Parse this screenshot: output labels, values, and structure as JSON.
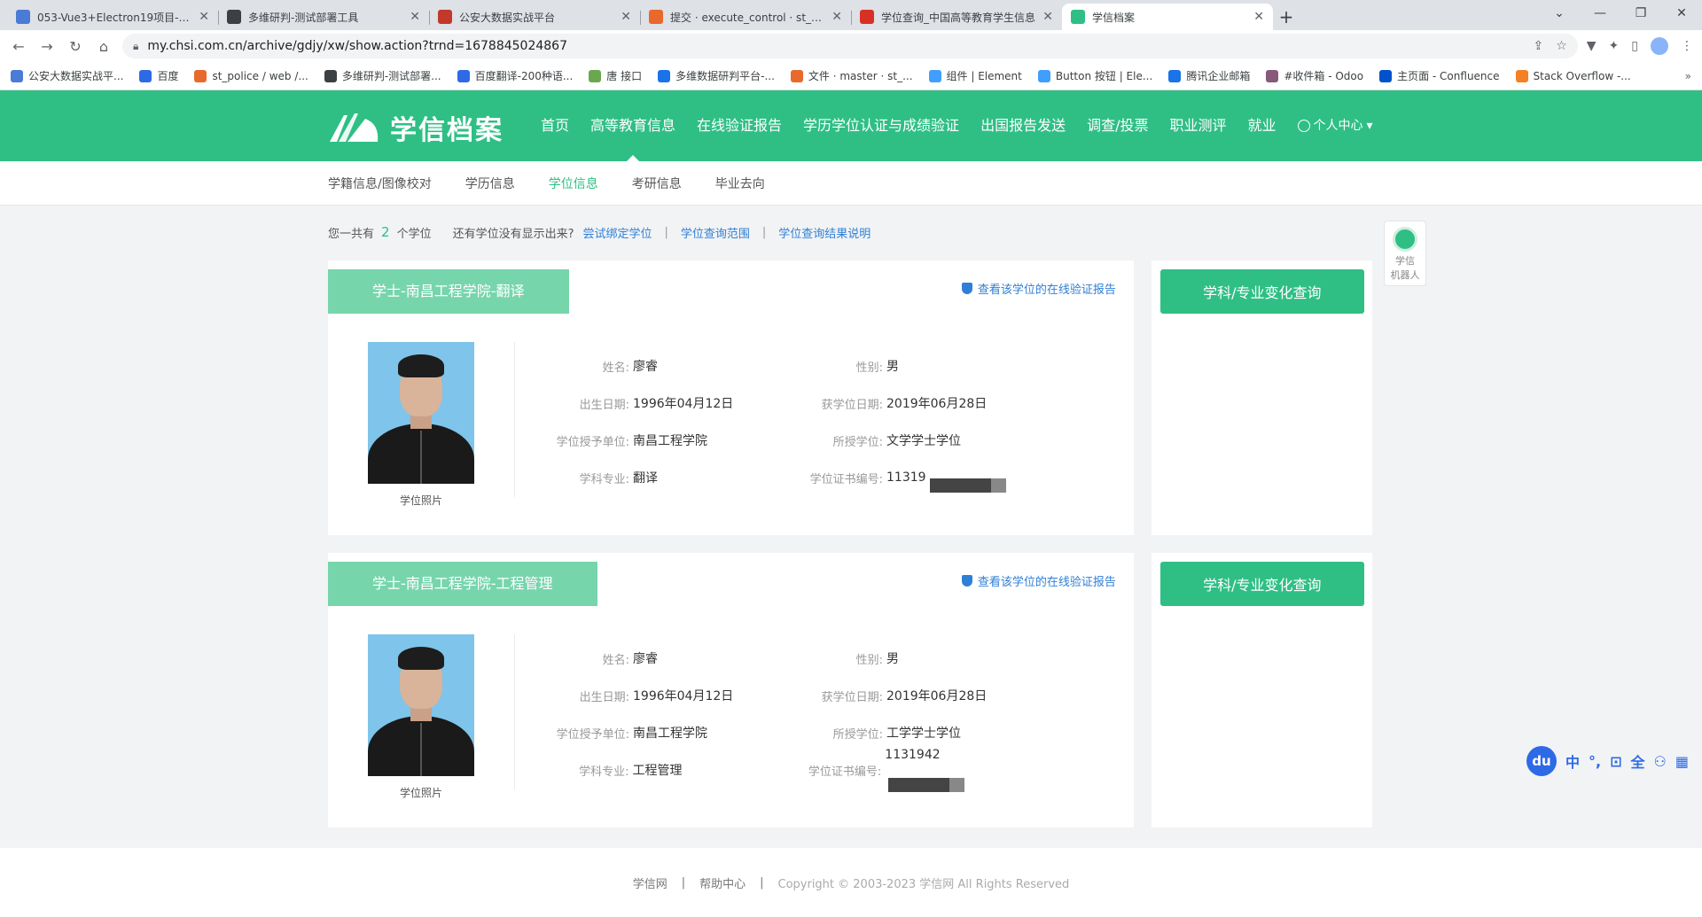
{
  "browser": {
    "tabs": [
      {
        "title": "053-Vue3+Electron19项目-17_",
        "icon_color": "#4a7bd6"
      },
      {
        "title": "多维研判-测试部署工具",
        "icon_color": "#3c4043"
      },
      {
        "title": "公安大数据实战平台",
        "icon_color": "#c0392b"
      },
      {
        "title": "提交 · execute_control · st_poli",
        "icon_color": "#e8692b"
      },
      {
        "title": "学位查询_中国高等教育学生信息",
        "icon_color": "#d93025"
      },
      {
        "title": "学信档案",
        "icon_color": "#2fbf85",
        "active": true
      }
    ],
    "url": "my.chsi.com.cn/archive/gdjy/xw/show.action?trnd=1678845024867",
    "bookmarks": [
      {
        "label": "公安大数据实战平...",
        "color": "#4a7bd6"
      },
      {
        "label": "百度",
        "color": "#2e6ae6"
      },
      {
        "label": "st_police / web /...",
        "color": "#e8692b"
      },
      {
        "label": "多维研判-测试部署...",
        "color": "#3c4043"
      },
      {
        "label": "百度翻译-200种语...",
        "color": "#2e6ae6"
      },
      {
        "label": "唐 接口",
        "color": "#6aa84f"
      },
      {
        "label": "多维数据研判平台-...",
        "color": "#1a73e8"
      },
      {
        "label": "文件 · master · st_...",
        "color": "#e8692b"
      },
      {
        "label": "组件 | Element",
        "color": "#409eff"
      },
      {
        "label": "Button 按钮 | Ele...",
        "color": "#409eff"
      },
      {
        "label": "腾讯企业邮箱",
        "color": "#1a73e8"
      },
      {
        "label": "#收件箱 - Odoo",
        "color": "#875a7b"
      },
      {
        "label": "主页面 - Confluence",
        "color": "#0052cc"
      },
      {
        "label": "Stack Overflow -...",
        "color": "#f48024"
      }
    ],
    "bookmarks_more": "»"
  },
  "site": {
    "logo_text": "学信档案",
    "nav": [
      {
        "label": "首页"
      },
      {
        "label": "高等教育信息",
        "active": true
      },
      {
        "label": "在线验证报告"
      },
      {
        "label": "学历学位认证与成绩验证"
      },
      {
        "label": "出国报告发送"
      },
      {
        "label": "调查/投票"
      },
      {
        "label": "职业测评"
      },
      {
        "label": "就业"
      }
    ],
    "user_menu": "个人中心",
    "subnav": [
      {
        "label": "学籍信息/图像校对"
      },
      {
        "label": "学历信息"
      },
      {
        "label": "学位信息",
        "active": true
      },
      {
        "label": "考研信息"
      },
      {
        "label": "毕业去向"
      }
    ]
  },
  "summary": {
    "prefix": "您一共有",
    "count": "2",
    "suffix": "个学位",
    "question": "还有学位没有显示出来?",
    "link_bind": "尝试绑定学位",
    "link_scope": "学位查询范围",
    "link_explain": "学位查询结果说明",
    "sep": "|"
  },
  "degrees": [
    {
      "title": "学士-南昌工程学院-翻译",
      "verify_link": "查看该学位的在线验证报告",
      "photo_label": "学位照片",
      "name_label": "姓名:",
      "name": "廖睿",
      "gender_label": "性别:",
      "gender": "男",
      "birth_label": "出生日期:",
      "birth": "1996年04月12日",
      "date_label": "获学位日期:",
      "date": "2019年06月28日",
      "unit_label": "学位授予单位:",
      "unit": "南昌工程学院",
      "degree_label": "所授学位:",
      "degree": "文学学士学位",
      "major_label": "学科专业:",
      "major": "翻译",
      "cert_label": "学位证书编号:",
      "cert": "11319",
      "side_button": "学科/专业变化查询"
    },
    {
      "title": "学士-南昌工程学院-工程管理",
      "verify_link": "查看该学位的在线验证报告",
      "photo_label": "学位照片",
      "name_label": "姓名:",
      "name": "廖睿",
      "gender_label": "性别:",
      "gender": "男",
      "birth_label": "出生日期:",
      "birth": "1996年04月12日",
      "date_label": "获学位日期:",
      "date": "2019年06月28日",
      "unit_label": "学位授予单位:",
      "unit": "南昌工程学院",
      "degree_label": "所授学位:",
      "degree": "工学学士学位",
      "major_label": "学科专业:",
      "major": "工程管理",
      "cert_label": "学位证书编号:",
      "cert": "1131942",
      "side_button": "学科/专业变化查询"
    }
  ],
  "robot": {
    "line1": "学信",
    "line2": "机器人"
  },
  "ime": {
    "logo": "du",
    "keys": [
      "中",
      "°,",
      "⊡",
      "全",
      "⚇",
      "▦"
    ]
  },
  "footer": {
    "link1": "学信网",
    "link2": "帮助中心",
    "sep": "|",
    "copyright": "Copyright © 2003-2023 学信网 All Rights Reserved"
  }
}
